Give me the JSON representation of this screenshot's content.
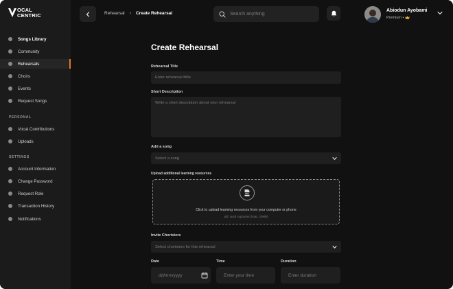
{
  "brand": {
    "line1": "OCAL",
    "line2": "CENTRIC"
  },
  "sidebar": {
    "main_items": [
      {
        "label": "Songs Library",
        "icon": "music-note-icon"
      },
      {
        "label": "Community",
        "icon": "community-icon"
      },
      {
        "label": "Rehearsals",
        "icon": "rehearsal-icon"
      },
      {
        "label": "Choirs",
        "icon": "choir-icon"
      },
      {
        "label": "Events",
        "icon": "calendar-icon"
      },
      {
        "label": "Request Songs",
        "icon": "request-icon"
      }
    ],
    "personal_label": "PERSONAL",
    "personal_items": [
      {
        "label": "Vocal Contributions",
        "icon": "microphone-icon"
      },
      {
        "label": "Uploads",
        "icon": "upload-icon"
      }
    ],
    "settings_label": "SETTINGS",
    "settings_items": [
      {
        "label": "Account Information",
        "icon": "user-icon"
      },
      {
        "label": "Change Password",
        "icon": "lock-icon"
      },
      {
        "label": "Request Role",
        "icon": "role-icon"
      },
      {
        "label": "Transaction History",
        "icon": "history-icon"
      },
      {
        "label": "Notifications",
        "icon": "bell-icon"
      }
    ]
  },
  "header": {
    "breadcrumb_parent": "Rehearsal",
    "breadcrumb_sep": "›",
    "breadcrumb_current": "Create Rehearsal",
    "search_placeholder": "Search anything",
    "user_name": "Abiodun Ayobami",
    "user_plan": "Premium •",
    "plan_icon": "crown-icon"
  },
  "form": {
    "title": "Create Rehearsal",
    "rehearsal_title_label": "Rehearsal Title",
    "rehearsal_title_placeholder": "Enter rehearsal tittle",
    "description_label": "Short Description",
    "description_placeholder": "Write a short description about your rehearsal",
    "song_label": "Add a song",
    "song_placeholder": "Select a song",
    "upload_label": "Upload additional learning resources",
    "upload_badge": "PDF",
    "upload_text": "Click to upload learning resources from your computer or phone",
    "upload_sub": "pdf, word supported (max. 20MB)",
    "invite_label": "Invite Choristers",
    "invite_placeholder": "Select choristers for this rehearsal",
    "date_label": "Date",
    "date_placeholder": "dd/mm/yyyy",
    "time_label": "Time",
    "time_placeholder": "Enter your time",
    "duration_label": "Duration",
    "duration_placeholder": "Enter duration"
  },
  "colors": {
    "accent": "#e8772e",
    "bg": "#111111",
    "sidebar": "#1b1b1b",
    "field": "#1f1f1f"
  }
}
